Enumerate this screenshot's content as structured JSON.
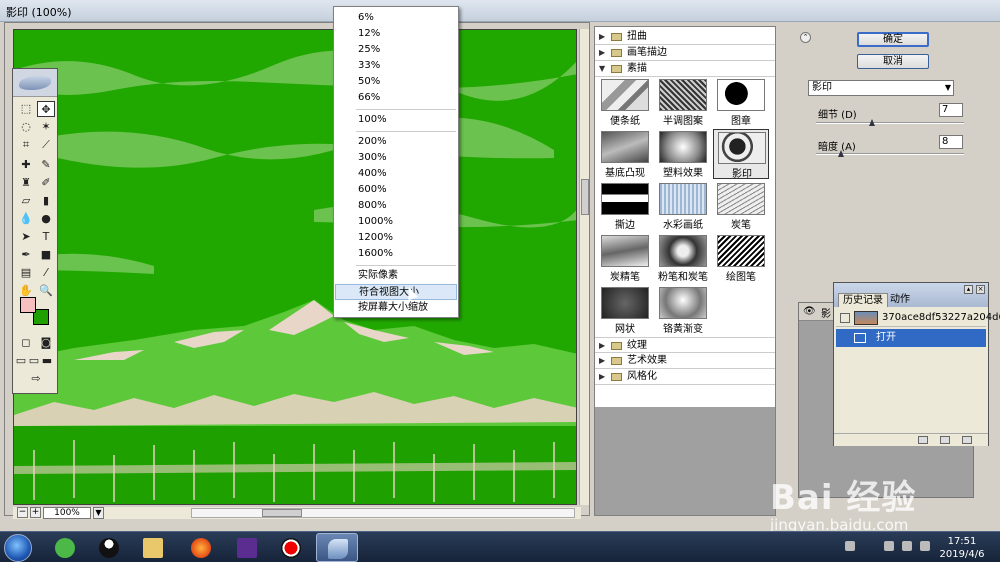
{
  "window": {
    "title": "影印 (100%)",
    "faded_title": ""
  },
  "zoom_menu": {
    "items": [
      "6%",
      "12%",
      "25%",
      "33%",
      "50%",
      "66%",
      "100%",
      "200%",
      "300%",
      "400%",
      "600%",
      "800%",
      "1000%",
      "1200%",
      "1600%",
      "实际像素",
      "符合视图大小",
      "按屏幕大小缩放"
    ],
    "highlighted": "符合视图大小"
  },
  "statusbar": {
    "zoom": "100%",
    "minus": "−",
    "plus": "+"
  },
  "gallery": {
    "categories_top": [
      "扭曲",
      "画笔描边",
      "素描"
    ],
    "open_category": "素描",
    "thumbs": [
      "便条纸",
      "半调图案",
      "图章",
      "基底凸现",
      "塑料效果",
      "影印",
      "撕边",
      "水彩画纸",
      "炭笔",
      "炭精笔",
      "粉笔和炭笔",
      "绘图笔",
      "网状",
      "铬黄渐变"
    ],
    "selected_thumb": "影印",
    "categories_bottom": [
      "纹理",
      "艺术效果",
      "风格化"
    ]
  },
  "controls": {
    "ok": "确定",
    "cancel": "取消",
    "filter": "影印",
    "params": [
      {
        "label": "细节 (D)",
        "value": "7",
        "level": 0.38
      },
      {
        "label": "暗度 (A)",
        "value": "8",
        "level": 0.17
      }
    ],
    "layer_label": "影"
  },
  "history": {
    "tab_history": "历史记录",
    "tab_actions": "动作",
    "snapshot": "370ace8df53227a204d6...",
    "step": "打开"
  },
  "taskbar": {
    "time": "17:51",
    "date": "2019/4/6"
  },
  "watermark": {
    "brand": "Bai 经验",
    "url": "jingyan.baidu.com"
  },
  "colors": {
    "canvas": "#21a800",
    "foreground": "#f7c0c0",
    "background": "#20a000",
    "selection": "#316ac5"
  }
}
